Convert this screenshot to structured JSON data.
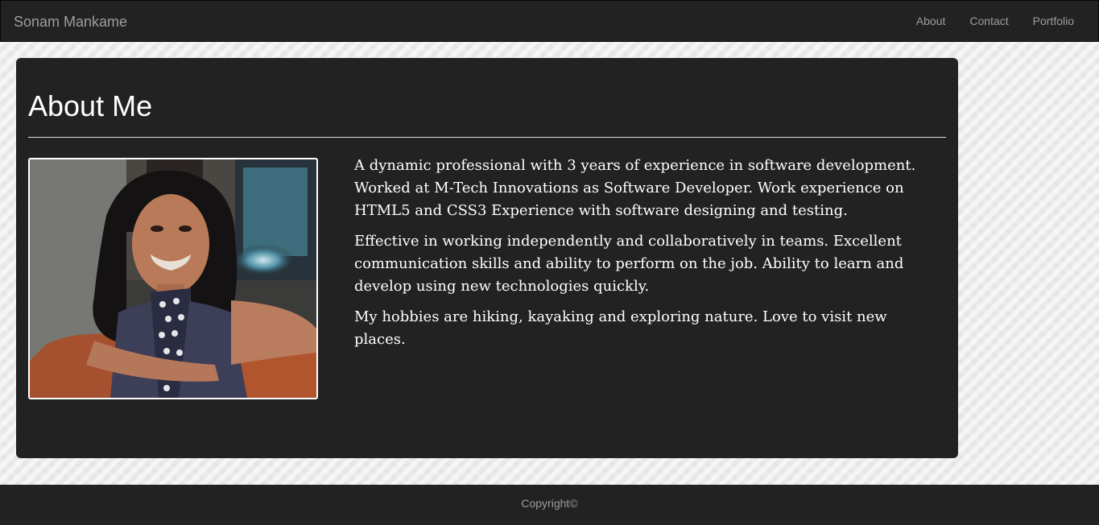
{
  "navbar": {
    "brand": "Sonam Mankame",
    "links": [
      "About",
      "Contact",
      "Portfolio"
    ]
  },
  "main": {
    "heading": "About Me",
    "paragraphs": [
      "A dynamic professional with 3 years of experience in software development. Worked at M-Tech Innovations as Software Developer. Work experience on HTML5 and CSS3 Experience with software designing and testing.",
      "Effective in working independently and collaboratively in teams. Excellent communication skills and ability to perform on the job. Ability to learn and develop using new technologies quickly.",
      "My hobbies are hiking, kayaking and exploring nature. Love to visit new places."
    ]
  },
  "footer": {
    "text": "Copyright©"
  },
  "colors": {
    "navbar_bg": "#222222",
    "panel_bg": "#222222",
    "nav_text": "#9d9d9d",
    "body_text": "#ffffff",
    "page_bg": "#ebebeb"
  }
}
